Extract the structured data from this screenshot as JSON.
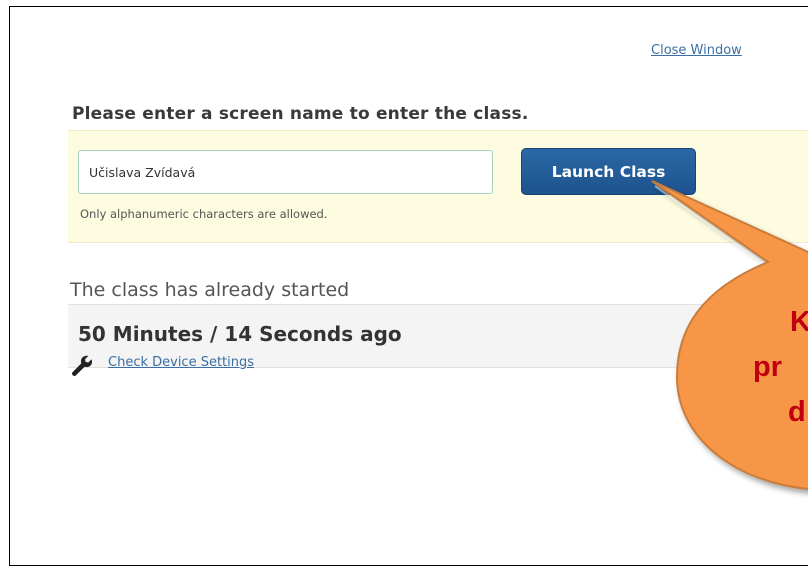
{
  "window": {
    "close_label": "Close Window"
  },
  "form": {
    "heading": "Please enter a screen name to enter the class.",
    "name_value": "Učislava Zvídavá",
    "launch_label": "Launch Class",
    "hint": "Only alphanumeric characters are allowed."
  },
  "session": {
    "started_label": "The class has already started",
    "elapsed": "50 Minutes / 14 Seconds ago",
    "device_settings_label": "Check Device Settings"
  },
  "callout": {
    "lines": [
      "K",
      "pr",
      "d"
    ],
    "fill": "#f79646",
    "text_color": "#c0000f"
  },
  "icons": {
    "device_settings": "wrench-icon"
  }
}
